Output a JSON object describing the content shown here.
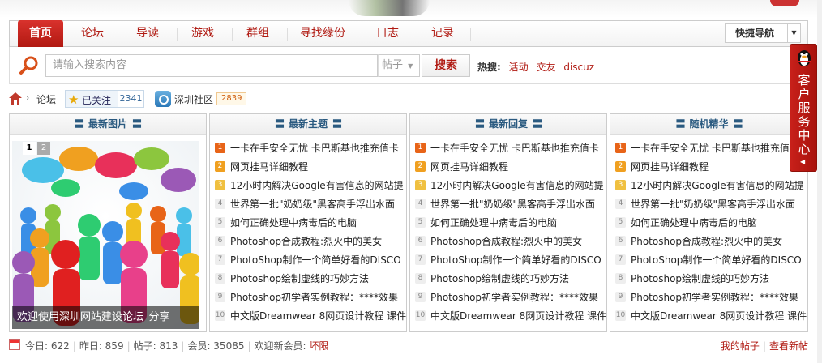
{
  "nav": {
    "home": "首页",
    "items": [
      "论坛",
      "导读",
      "游戏",
      "群组",
      "寻找缘份",
      "日志",
      "记录"
    ],
    "quick_nav": "快捷导航"
  },
  "search": {
    "placeholder": "请输入搜索内容",
    "type": "帖子",
    "button": "搜索",
    "hot_label": "热搜:",
    "hot_keywords": [
      "活动",
      "交友",
      "discuz"
    ]
  },
  "breadcrumb": {
    "forum": "论坛",
    "followed_label": "已关注",
    "followed_count": "2341",
    "community": "深圳社区",
    "community_count": "2839"
  },
  "panels": [
    {
      "title": "最新图片"
    },
    {
      "title": "最新主题"
    },
    {
      "title": "最新回复"
    },
    {
      "title": "随机精华"
    }
  ],
  "photo": {
    "caption": "欢迎使用深圳网站建设论坛_分享",
    "slides": [
      "1",
      "2"
    ]
  },
  "topics": [
    "一卡在手安全无忧 卡巴斯基也推充值卡",
    "网页挂马详细教程",
    "12小时内解决Google有害信息的网站提",
    "世界第一批\"奶奶级\"黑客高手浮出水面",
    "如何正确处理中病毒后的电脑",
    "Photoshop合成教程:烈火中的美女",
    "PhotoShop制作一个简单好看的DISCO",
    "Photoshop绘制虚线的巧妙方法",
    "Photoshop初学者实例教程：****效果",
    "中文版Dreamwear 8网页设计教程 课件"
  ],
  "numbers": [
    "1",
    "2",
    "3",
    "4",
    "5",
    "6",
    "7",
    "8",
    "9",
    "10"
  ],
  "stats": {
    "today": "今日: 622",
    "yesterday": "昨日: 859",
    "posts": "帖子: 813",
    "members": "会员: 35085",
    "welcome": "欢迎新会员:",
    "new_member": "坏限",
    "my_posts": "我的帖子",
    "new_posts": "查看新帖"
  },
  "service": {
    "label": "客户服务中心"
  },
  "colors": {
    "brand_red": "#b01a12",
    "panel_title": "#2a5a80"
  }
}
